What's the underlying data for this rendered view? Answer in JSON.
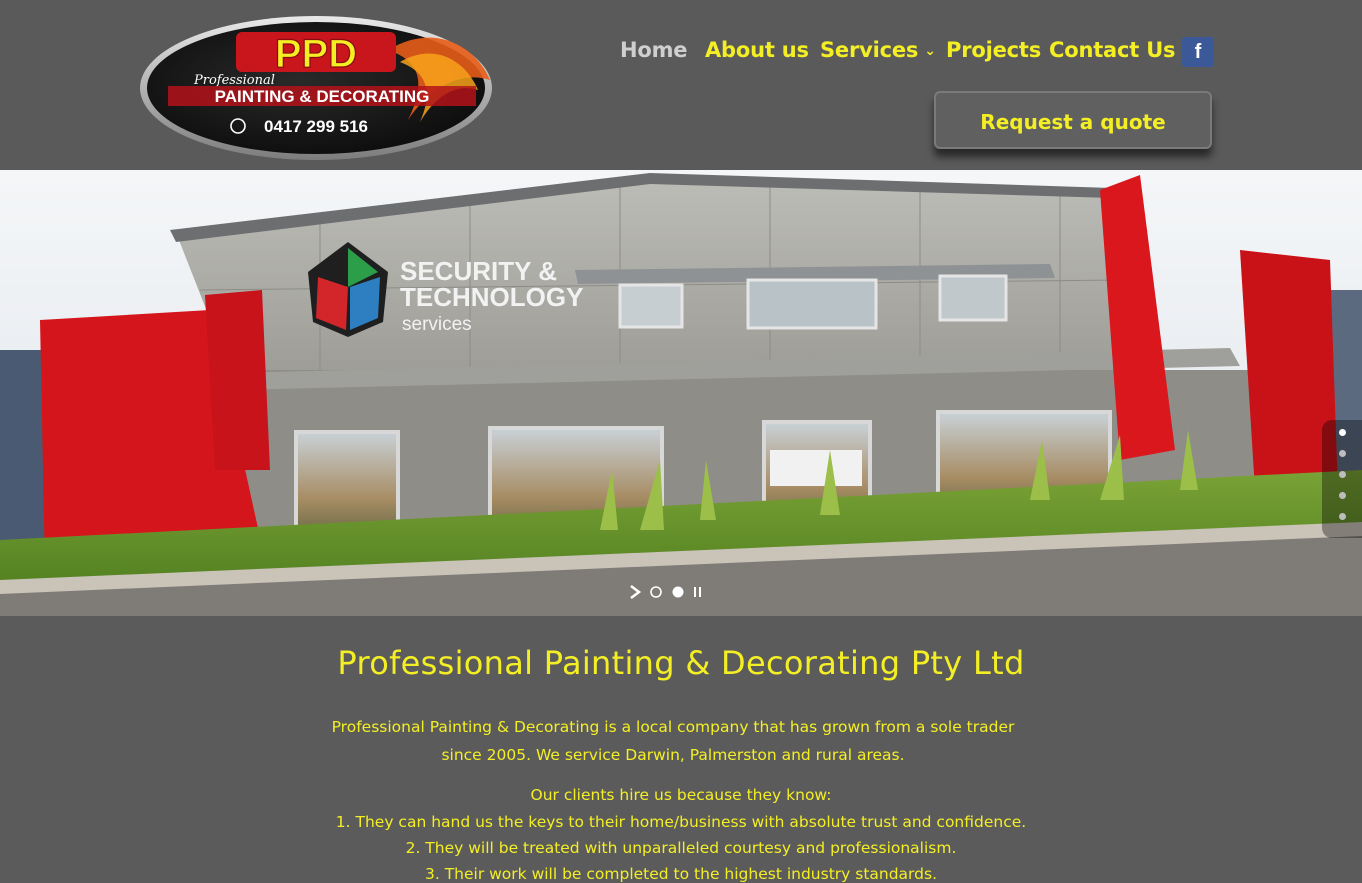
{
  "logo": {
    "brand": "PPD",
    "tagline_script": "Professional",
    "tagline": "PAINTING & DECORATING",
    "phone": "0417 299 516"
  },
  "nav": {
    "items": [
      {
        "label": "Home"
      },
      {
        "label": "About us"
      },
      {
        "label": "Services"
      },
      {
        "label": "Projects"
      },
      {
        "label": "Contact Us"
      }
    ],
    "facebook_icon": "f",
    "quote_button": "Request a quote"
  },
  "slider": {
    "sign_line1": "SECURITY &",
    "sign_line2": "TECHNOLOGY",
    "sign_line3": "services",
    "slide_count": 5,
    "active_slide": 1,
    "controls": {
      "next_icon": "play-arrow-icon",
      "pause_icon": "pause-icon"
    }
  },
  "content": {
    "title": "Professional Painting & Decorating Pty Ltd",
    "intro": "Professional Painting & Decorating is a local company that has grown from a sole trader since 2005. We service Darwin, Palmerston and rural areas.",
    "clients_lead": "Our clients hire us because they know:",
    "reasons": [
      "1. They can hand us the keys to their home/business with absolute trust and confidence.",
      "2. They will be treated with unparalleled courtesy and professionalism.",
      "3. Their work will be completed to the highest industry standards."
    ]
  },
  "colors": {
    "accent": "#f4ef24",
    "background": "#5b5b5b",
    "facebook": "#3b5998"
  }
}
